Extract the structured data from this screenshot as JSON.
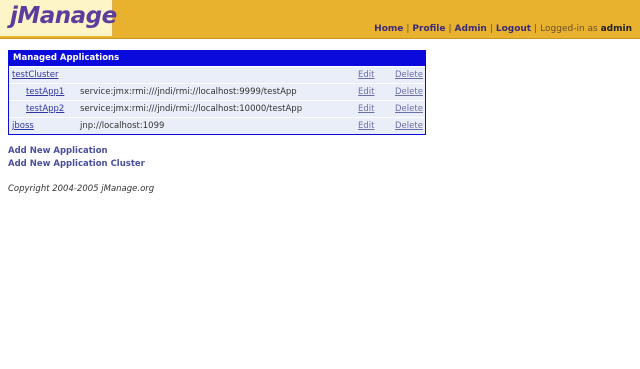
{
  "header": {
    "logo_text": "jManage",
    "nav": {
      "home": "Home",
      "profile": "Profile",
      "admin": "Admin",
      "logout": "Logout",
      "separator": "|",
      "logged_in_prefix": "Logged-in as",
      "user": "admin"
    }
  },
  "apps": {
    "title": "Managed Applications",
    "rows": [
      {
        "name": "testCluster",
        "url": "",
        "edit": "Edit",
        "delete": "Delete"
      },
      {
        "name": "testApp1",
        "url": "service:jmx:rmi:///jndi/rmi://localhost:9999/testApp",
        "edit": "Edit",
        "delete": "Delete"
      },
      {
        "name": "testApp2",
        "url": "service:jmx:rmi:///jndi/rmi://localhost:10000/testApp",
        "edit": "Edit",
        "delete": "Delete"
      },
      {
        "name": "jboss",
        "url": "jnp://localhost:1099",
        "edit": "Edit",
        "delete": "Delete"
      }
    ]
  },
  "links": {
    "add_app": "Add New Application",
    "add_cluster": "Add New Application Cluster"
  },
  "footer": {
    "copyright": "Copyright 2004-2005 jManage.org"
  },
  "colors": {
    "header_bg": "#e8b22e",
    "table_header_bg": "#0a0adc",
    "row_bg": "#e9eef8",
    "link": "#3236a3"
  }
}
